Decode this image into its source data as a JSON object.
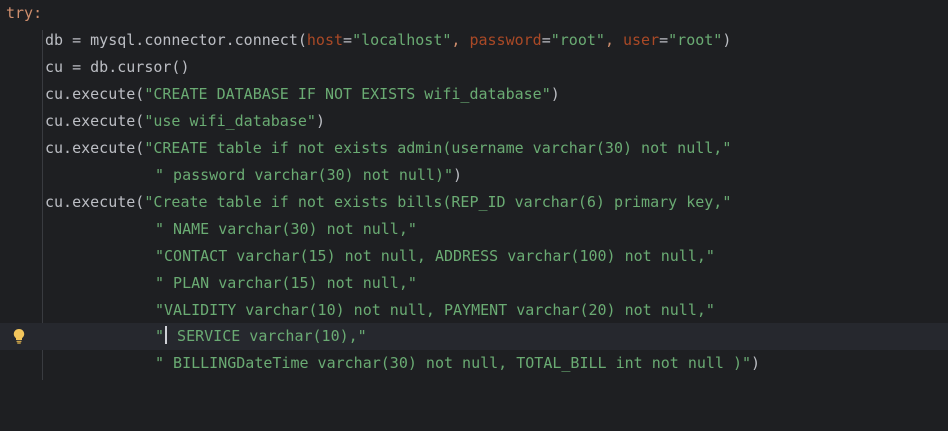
{
  "lines": {
    "l0": {
      "kw": "try",
      "colon": ":"
    },
    "l1": {
      "a": "db = mysql.connector.connect(",
      "p1": "host",
      "eq1": "=",
      "s1": "\"localhost\"",
      "c1": ", ",
      "p2": "password",
      "eq2": "=",
      "s2": "\"root\"",
      "c2": ", ",
      "p3": "user",
      "eq3": "=",
      "s3": "\"root\"",
      "end": ")"
    },
    "l2": {
      "a": "cu = db.cursor()"
    },
    "l3": {
      "a": "cu.execute(",
      "s": "\"CREATE DATABASE IF NOT EXISTS wifi_database\"",
      "end": ")"
    },
    "l4": {
      "a": "cu.execute(",
      "s": "\"use wifi_database\"",
      "end": ")"
    },
    "l5": {
      "a": "cu.execute(",
      "s": "\"CREATE table if not exists admin(username varchar(30) not null,\""
    },
    "l6": {
      "s": "\" password varchar(30) not null)\"",
      "end": ")"
    },
    "l7": {
      "a": "cu.execute(",
      "s": "\"Create table if not exists bills(REP_ID varchar(6) primary key,\""
    },
    "l8": {
      "s": "\" NAME varchar(30) not null,\""
    },
    "l9": {
      "s": "\"CONTACT varchar(15) not null, ADDRESS varchar(100) not null,\""
    },
    "l10": {
      "s": "\" PLAN varchar(15) not null,\""
    },
    "l11": {
      "s": "\"VALIDITY varchar(10) not null, PAYMENT varchar(20) not null,\""
    },
    "l12": {
      "s_a": "\"",
      "s_b": " SERVICE varchar(10),\""
    },
    "l13": {
      "s": "\" BILLINGDateTime varchar(30) not null, TOTAL_BILL int not null )\"",
      "end": ")"
    }
  },
  "gutter": {
    "intention_icon": "lightbulb-icon"
  },
  "colors": {
    "background": "#1e1f22",
    "current_line": "#26282e",
    "keyword": "#cf8e6d",
    "string": "#6aab73",
    "named_param": "#aa4926",
    "default_text": "#bcbec4",
    "bulb": "#f2c55c"
  }
}
